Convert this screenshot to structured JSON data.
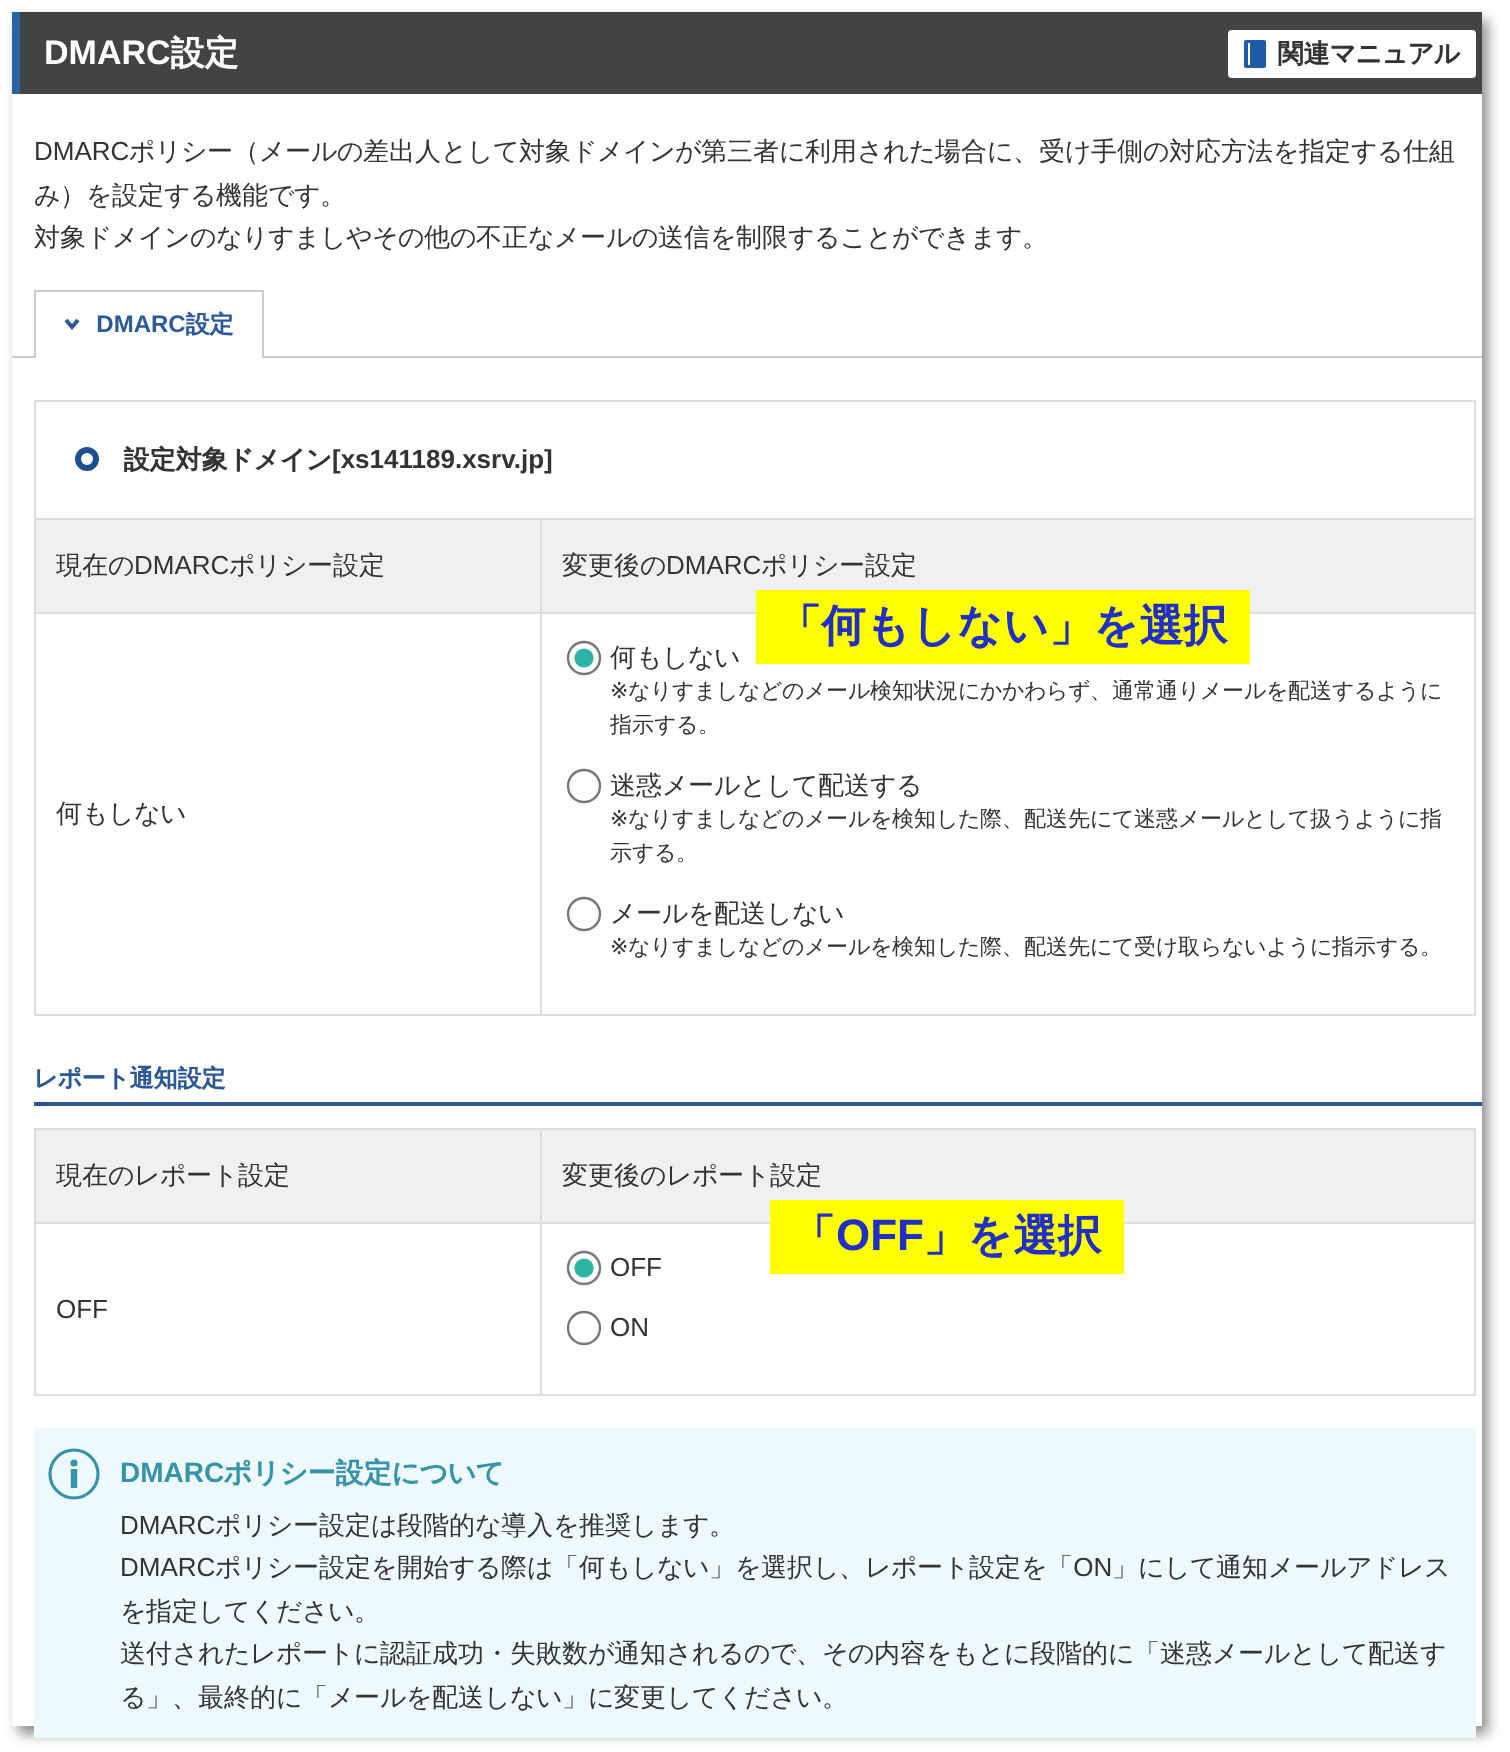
{
  "header": {
    "title": "DMARC設定",
    "manual_button": "関連マニュアル"
  },
  "description": [
    "DMARCポリシー（メールの差出人として対象ドメインが第三者に利用された場合に、受け手側の対応方法を指定する仕組み）を設定する機能です。",
    "対象ドメインのなりすましやその他の不正なメールの送信を制限することができます。"
  ],
  "tabs": [
    {
      "label": "DMARC設定",
      "selected": true
    }
  ],
  "domain": {
    "label": "設定対象ドメイン[xs141189.xsrv.jp]"
  },
  "policy_table": {
    "columns": [
      "現在のDMARCポリシー設定",
      "変更後のDMARCポリシー設定"
    ],
    "current": "何もしない",
    "options": [
      {
        "label": "何もしない",
        "note": "※なりすましなどのメール検知状況にかかわらず、通常通りメールを配送するように指示する。",
        "selected": true
      },
      {
        "label": "迷惑メールとして配送する",
        "note": "※なりすましなどのメールを検知した際、配送先にて迷惑メールとして扱うように指示する。",
        "selected": false
      },
      {
        "label": "メールを配送しない",
        "note": "※なりすましなどのメールを検知した際、配送先にて受け取らないように指示する。",
        "selected": false
      }
    ],
    "callout": "「何もしない」を選択"
  },
  "report_section": {
    "title": "レポート通知設定"
  },
  "report_table": {
    "columns": [
      "現在のレポート設定",
      "変更後のレポート設定"
    ],
    "current": "OFF",
    "options": [
      {
        "label": "OFF",
        "selected": true
      },
      {
        "label": "ON",
        "selected": false
      }
    ],
    "callout": "「OFF」を選択"
  },
  "info": {
    "title": "DMARCポリシー設定について",
    "paragraphs": [
      "DMARCポリシー設定は段階的な導入を推奨します。",
      "DMARCポリシー設定を開始する際は「何もしない」を選択し、レポート設定を「ON」にして通知メールアドレスを指定してください。",
      "送付されたレポートに認証成功・失敗数が通知されるので、その内容をもとに段階的に「迷惑メールとして配送する」、最終的に「メールを配送しない」に変更してください。"
    ]
  }
}
